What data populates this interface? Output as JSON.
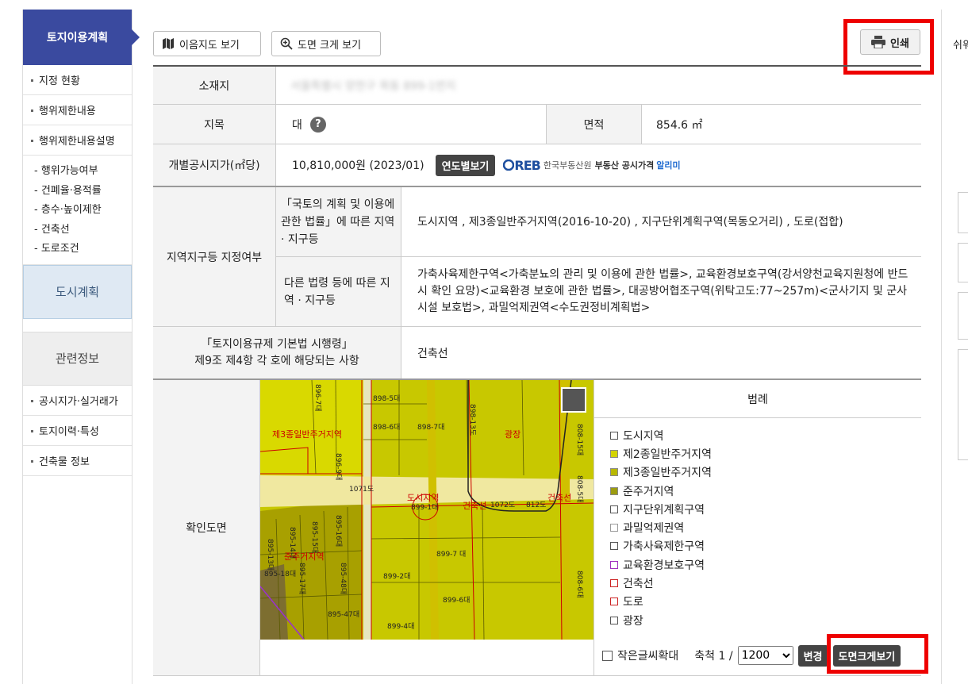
{
  "sidebar": {
    "title": "토지이용계획",
    "items": [
      "지정 현황",
      "행위제한내용",
      "행위제한내용설명"
    ],
    "sub_items": [
      "- 행위가능여부",
      "- 건폐율·용적률",
      "- 층수·높이제한",
      "- 건축선",
      "- 도로조건"
    ],
    "city_plan": "도시계획",
    "related": "관련정보",
    "related_items": [
      "공시지가·실거래가",
      "토지이력·특성",
      "건축물 정보"
    ]
  },
  "toolbar": {
    "map_btn": "이음지도 보기",
    "zoom_btn": "도면 크게 보기",
    "print_btn": "인쇄"
  },
  "right_panel": {
    "label": "쉬워"
  },
  "table": {
    "address_label": "소재지",
    "address_value": "서울특별시 양천구 목동 899-1번지",
    "land_cat_label": "지목",
    "land_cat_value": "대",
    "help_icon": "?",
    "area_label": "면적",
    "area_value": "854.6 ㎡",
    "price_label": "개별공시지가(㎡당)",
    "price_value": "10,810,000원 (2023/01)",
    "year_btn": "연도별보기",
    "reb_logo": "REB",
    "reb_org": "한국부동산원",
    "reb_text1": "부동산 공시가격",
    "reb_text2": "알리미",
    "zone_label": "지역지구등 지정여부",
    "zone_sub1_label": "「국토의 계획 및 이용에 관한 법률」에 따른 지역 · 지구등",
    "zone_sub1_value": "도시지역 , 제3종일반주거지역(2016-10-20) , 지구단위계획구역(목동오거리) , 도로(접합)",
    "zone_sub2_label": "다른 법령 등에 따른 지역 · 지구등",
    "zone_sub2_value": "가축사육제한구역<가축분뇨의 관리 및 이용에 관한 법률>, 교육환경보호구역(강서양천교육지원청에 반드시 확인 요망)<교육환경 보호에 관한 법률>, 대공방어협조구역(위탁고도:77~257m)<군사기지 및 군사시설 보호법>, 과밀억제권역<수도권정비계획법>",
    "decree_label_1": "「토지이용규제 기본법 시행령」",
    "decree_label_2": "제9조 제4항 각 호에 해당되는 사항",
    "decree_value": "건축선",
    "map_label": "확인도면"
  },
  "map": {
    "labels": [
      "898-5대",
      "898-6대",
      "898-7대",
      "898-13도",
      "808-15대",
      "광장",
      "제3종일반주거지역",
      "1071도",
      "도시지역",
      "899-1대",
      "건축선",
      "1072도",
      "812도",
      "808-5대",
      "건축선",
      "895-15대",
      "895-14대",
      "895-16대",
      "895-13대",
      "준주거지역",
      "895-18대",
      "895-17대",
      "895-48대",
      "899-7대",
      "899-2대",
      "899-6대",
      "899-4대",
      "808-6대",
      "895-47대",
      "898-7대",
      "896-9대"
    ]
  },
  "legend": {
    "title": "범례",
    "items": [
      {
        "label": "도시지역",
        "color": "#ffffff"
      },
      {
        "label": "제2종일반주거지역",
        "color": "#d4d400"
      },
      {
        "label": "제3종일반주거지역",
        "color": "#b8b800"
      },
      {
        "label": "준주거지역",
        "color": "#9c9c10"
      },
      {
        "label": "지구단위계획구역",
        "color": "#ffffff"
      },
      {
        "label": "과밀억제권역",
        "color": "#ffffff"
      },
      {
        "label": "가축사육제한구역",
        "color": "#ffffff"
      },
      {
        "label": "교육환경보호구역",
        "color": "#ffffff"
      },
      {
        "label": "건축선",
        "color": "#ffffff"
      },
      {
        "label": "도로",
        "color": "#ffffff"
      },
      {
        "label": "광장",
        "color": "#ffffff"
      }
    ],
    "border_colors": [
      "#555",
      "#888",
      "#888",
      "#888",
      "#555",
      "#999",
      "#555",
      "#a030c0",
      "#cc2222",
      "#cc2222",
      "#555"
    ]
  },
  "scale": {
    "small_text_label": "작은글씨확대",
    "scale_label": "축척 1 /",
    "scale_value": "1200",
    "change_btn": "변경",
    "big_btn": "도면크게보기"
  }
}
